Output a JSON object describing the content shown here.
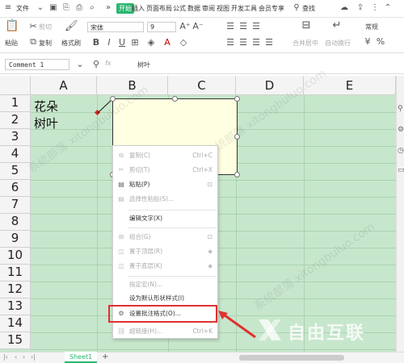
{
  "menubar": {
    "file": "文件",
    "tabs": [
      "开始",
      "插入",
      "页面布局",
      "公式",
      "数据",
      "审阅",
      "视图",
      "开发工具",
      "会员专享"
    ],
    "search": "查找"
  },
  "ribbon": {
    "paste": "粘贴",
    "cut": "剪切",
    "copy": "复制",
    "format_painter": "格式刷",
    "font": "宋体",
    "font_size": "9",
    "merge": "合并居中",
    "wrap": "自动换行",
    "normal": "常规"
  },
  "formula": {
    "namebox": "Comment 1",
    "fx": "fx",
    "value": "树叶"
  },
  "columns": [
    "A",
    "B",
    "C",
    "D",
    "E"
  ],
  "rows": [
    "1",
    "2",
    "3",
    "4",
    "5",
    "6",
    "7",
    "8",
    "9",
    "10",
    "11",
    "12",
    "13",
    "14",
    "15"
  ],
  "cells": {
    "a1": "花朵",
    "a2": "树叶"
  },
  "context_menu": {
    "copy": "复制(C)",
    "copy_sc": "Ctrl+C",
    "cut": "剪切(T)",
    "cut_sc": "Ctrl+X",
    "paste": "粘贴(P)",
    "paste_special": "选择性粘贴(S)...",
    "edit_text": "编辑文字(X)",
    "group": "组合(G)",
    "bring_front": "置于顶层(R)",
    "send_back": "置于底层(K)",
    "assign_macro": "指定宏(N)...",
    "set_default": "设为默认形状样式(I)",
    "format_comment": "设置批注格式(O)...",
    "hyperlink": "超链接(H)...",
    "hyperlink_sc": "Ctrl+K"
  },
  "sheet": {
    "name": "Sheet1",
    "add": "+"
  },
  "colors": {
    "accent": "#2bb672",
    "grid_bg": "#c7e7cc",
    "comment_bg": "#ffffe1",
    "highlight": "#e03131"
  },
  "watermark": "系统部落 xitongbuluo.com",
  "logo_text": "自由互联"
}
